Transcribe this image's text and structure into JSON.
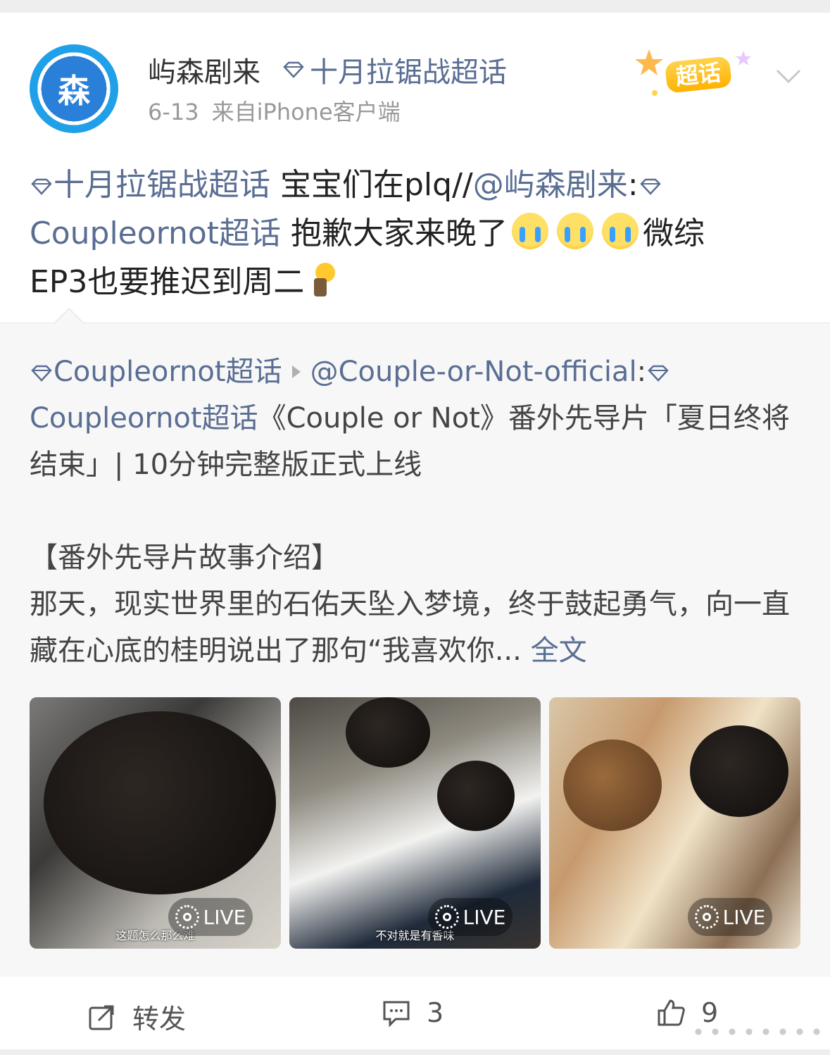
{
  "header": {
    "avatar_text": "森",
    "username": "屿森剧来",
    "super_topic": "十月拉锯战超话",
    "date": "6-13",
    "source": "来自iPhone客户端",
    "badge_label": "超话"
  },
  "post": {
    "topic_tag": "十月拉锯战超话",
    "text_1": " 宝宝们在plq//",
    "mention": "@屿森剧来",
    "colon": ":",
    "topic_tag_2": "Coupleornot超话",
    "text_2": " 抱歉大家来晚了",
    "text_3": "微综",
    "text_4": "EP3也要推迟到周二"
  },
  "repost": {
    "topic_tag": "Coupleornot超话",
    "mention": "@Couple-or-Not-official",
    "colon": ":",
    "topic_tag_2": "Coupleornot超话",
    "text_1": "《Couple or Not》番外先导片「夏日终将结束」| 10分钟完整版正式上线",
    "section_title": "【番外先导片故事介绍】",
    "text_2": "那天，现实世界里的石佑天坠入梦境，终于鼓起勇气，向一直藏在心底的桂明说出了那句“我喜欢你...",
    "more": " 全文"
  },
  "images": [
    {
      "live_label": "LIVE",
      "subtitle": "这题怎么那么难"
    },
    {
      "live_label": "LIVE",
      "subtitle": "不对就是有香味"
    },
    {
      "live_label": "LIVE",
      "subtitle": ""
    }
  ],
  "footer": {
    "share_label": "转发",
    "comment_count": "3",
    "like_count": "9"
  },
  "colors": {
    "link": "#5a6e93",
    "badge": "#ffb200",
    "background": "#eeeeee"
  }
}
